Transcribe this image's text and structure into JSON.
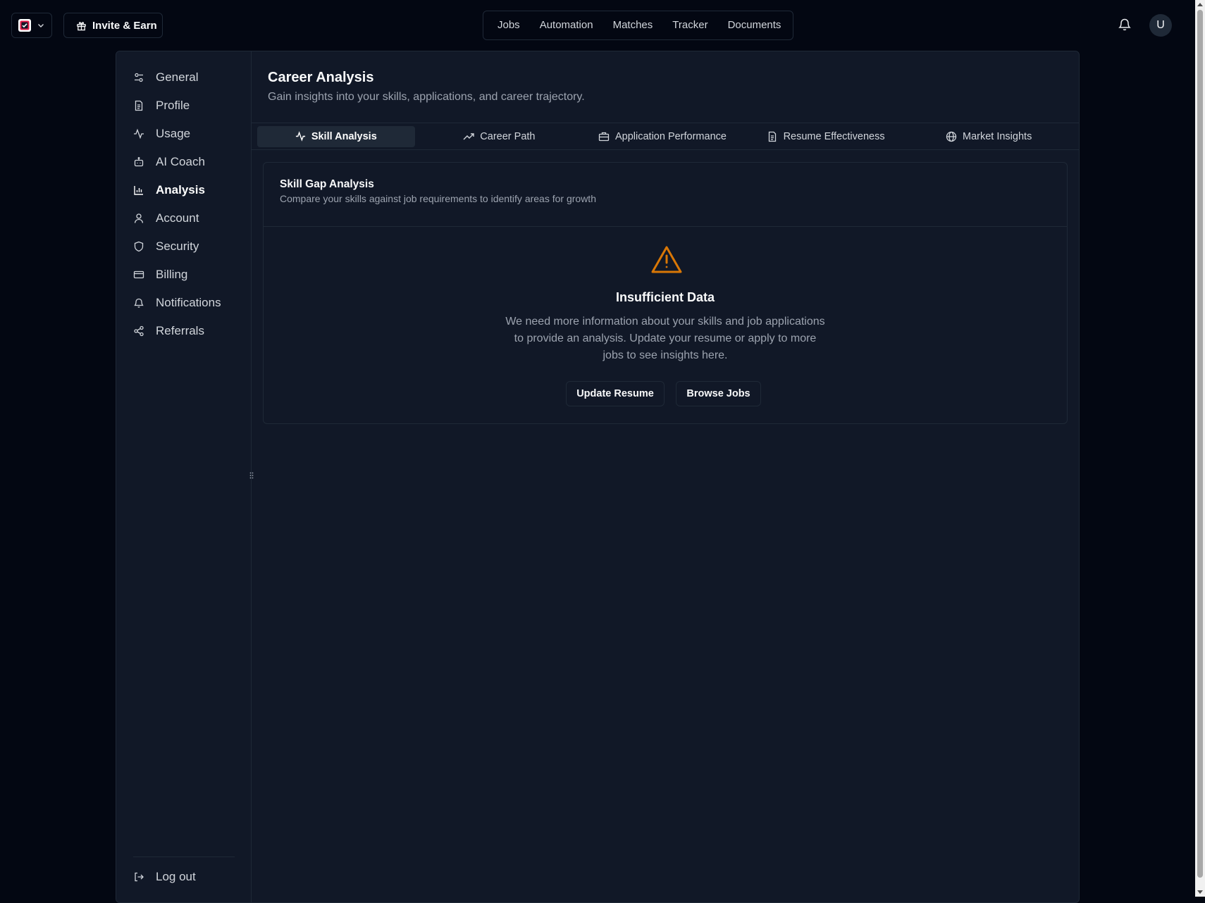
{
  "header": {
    "invite_label": "Invite & Earn",
    "nav": [
      "Jobs",
      "Automation",
      "Matches",
      "Tracker",
      "Documents"
    ],
    "avatar_initial": "U"
  },
  "sidebar": {
    "items": [
      {
        "label": "General",
        "icon": "sliders-icon"
      },
      {
        "label": "Profile",
        "icon": "file-icon"
      },
      {
        "label": "Usage",
        "icon": "activity-icon"
      },
      {
        "label": "AI Coach",
        "icon": "bot-icon"
      },
      {
        "label": "Analysis",
        "icon": "bar-chart-icon",
        "active": true
      },
      {
        "label": "Account",
        "icon": "user-icon"
      },
      {
        "label": "Security",
        "icon": "shield-icon"
      },
      {
        "label": "Billing",
        "icon": "credit-card-icon"
      },
      {
        "label": "Notifications",
        "icon": "bell-icon"
      },
      {
        "label": "Referrals",
        "icon": "share-icon"
      }
    ],
    "logout_label": "Log out"
  },
  "page": {
    "title": "Career Analysis",
    "subtitle": "Gain insights into your skills, applications, and career trajectory."
  },
  "tabs": [
    {
      "label": "Skill Analysis",
      "icon": "activity-icon",
      "active": true
    },
    {
      "label": "Career Path",
      "icon": "trending-up-icon"
    },
    {
      "label": "Application Performance",
      "icon": "briefcase-icon"
    },
    {
      "label": "Resume Effectiveness",
      "icon": "file-text-icon"
    },
    {
      "label": "Market Insights",
      "icon": "globe-icon"
    }
  ],
  "card": {
    "title": "Skill Gap Analysis",
    "subtitle": "Compare your skills against job requirements to identify areas for growth",
    "empty_title": "Insufficient Data",
    "empty_text": "We need more information about your skills and job applications to provide an analysis. Update your resume or apply to more jobs to see insights here.",
    "primary_button": "Update Resume",
    "secondary_button": "Browse Jobs"
  },
  "colors": {
    "background": "#030712",
    "panel": "#111827",
    "border": "#1f2937",
    "warning": "#d97706",
    "logo_accent": "#e11d48"
  }
}
